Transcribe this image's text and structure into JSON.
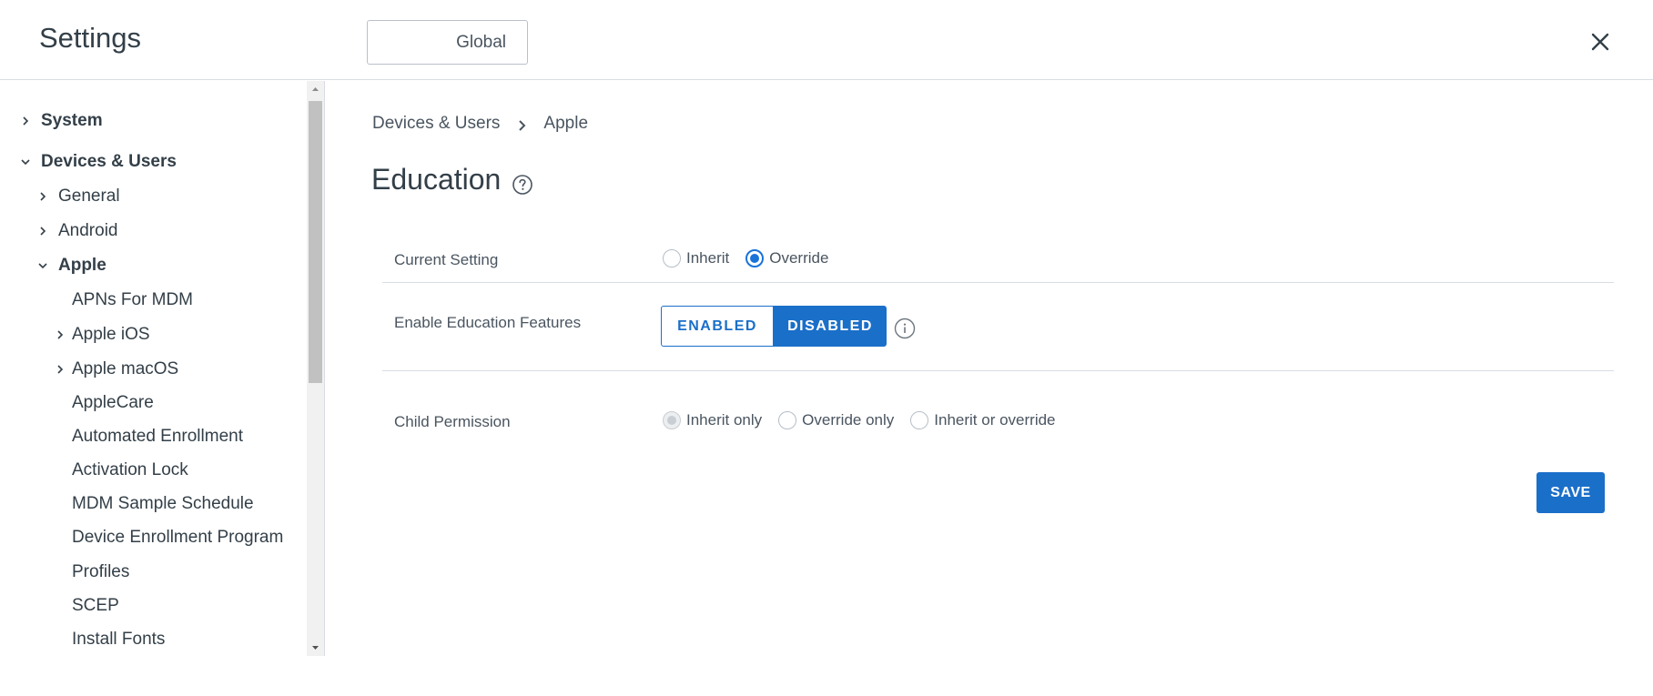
{
  "header": {
    "title": "Settings",
    "scope_label": "Global"
  },
  "sidebar": {
    "items": [
      {
        "label": "System",
        "level": 0,
        "chevron": "right"
      },
      {
        "label": "Devices & Users",
        "level": 0,
        "chevron": "down"
      },
      {
        "label": "General",
        "level": 1,
        "chevron": "right"
      },
      {
        "label": "Android",
        "level": 1,
        "chevron": "right"
      },
      {
        "label": "Apple",
        "level": 1,
        "chevron": "down"
      },
      {
        "label": "APNs For MDM",
        "level": 2,
        "chevron": "none"
      },
      {
        "label": "Apple iOS",
        "level": 2,
        "chevron": "right"
      },
      {
        "label": "Apple macOS",
        "level": 2,
        "chevron": "right"
      },
      {
        "label": "AppleCare",
        "level": 2,
        "chevron": "none"
      },
      {
        "label": "Automated Enrollment",
        "level": 2,
        "chevron": "none"
      },
      {
        "label": "Activation Lock",
        "level": 2,
        "chevron": "none"
      },
      {
        "label": "MDM Sample Schedule",
        "level": 2,
        "chevron": "none"
      },
      {
        "label": "Device Enrollment Program",
        "level": 2,
        "chevron": "none"
      },
      {
        "label": "Profiles",
        "level": 2,
        "chevron": "none"
      },
      {
        "label": "SCEP",
        "level": 2,
        "chevron": "none"
      },
      {
        "label": "Install Fonts",
        "level": 2,
        "chevron": "none"
      }
    ]
  },
  "breadcrumb": {
    "parent": "Devices & Users",
    "current": "Apple"
  },
  "page": {
    "title": "Education"
  },
  "form": {
    "current_setting": {
      "label": "Current Setting",
      "options": [
        "Inherit",
        "Override"
      ],
      "selected": "Override"
    },
    "education_features": {
      "label": "Enable Education Features",
      "enabled_label": "ENABLED",
      "disabled_label": "DISABLED",
      "selected": "DISABLED"
    },
    "child_permission": {
      "label": "Child Permission",
      "options": [
        "Inherit only",
        "Override only",
        "Inherit or override"
      ],
      "selected": "Inherit only"
    },
    "save_label": "SAVE"
  },
  "colors": {
    "accent": "#1a6fc9",
    "text": "#333f48",
    "border": "#d8dde3"
  }
}
